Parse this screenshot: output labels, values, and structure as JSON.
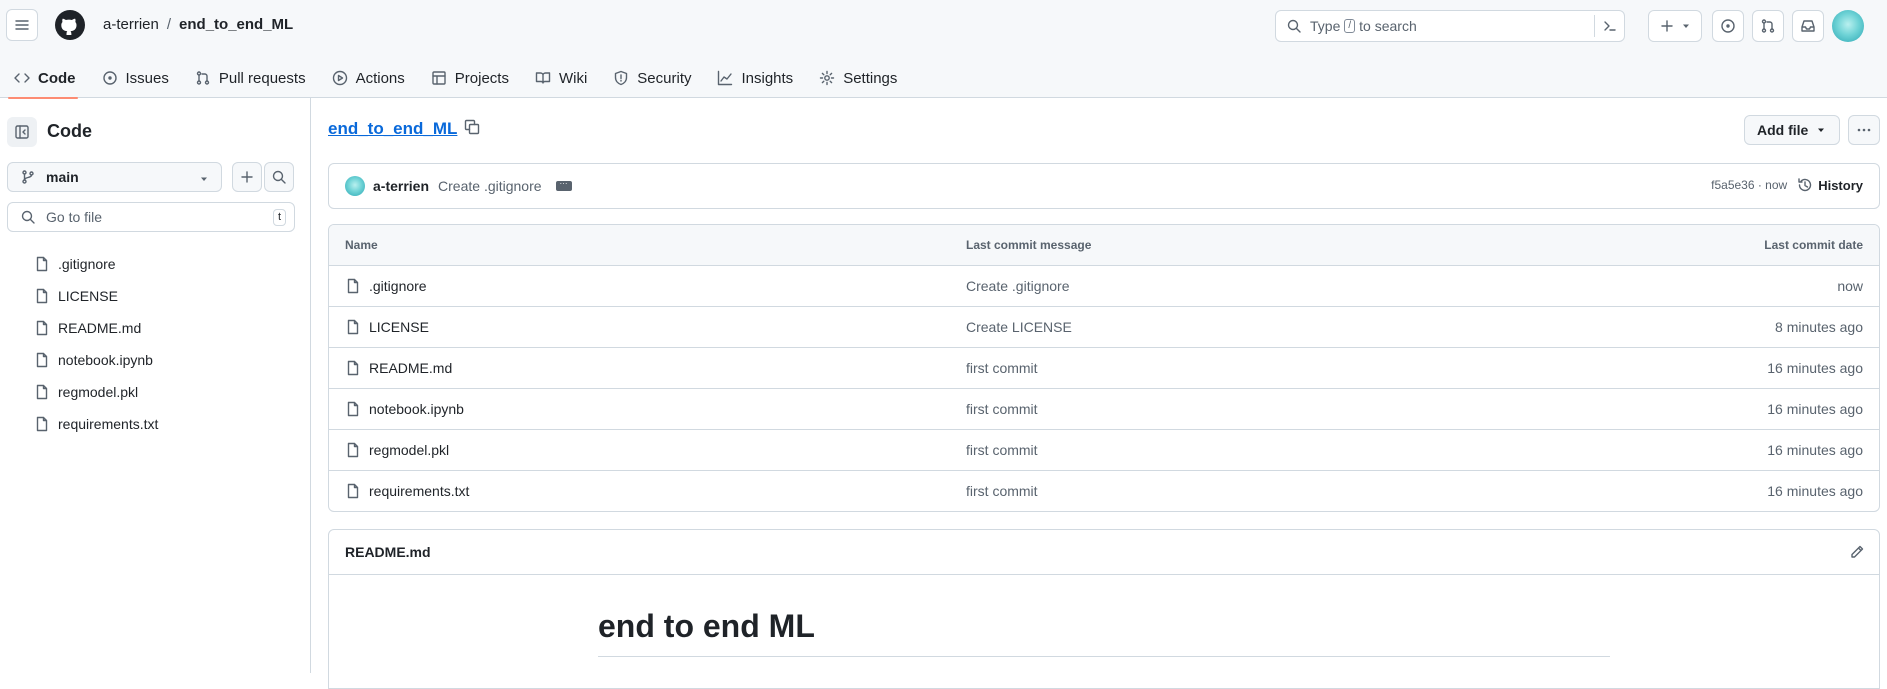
{
  "header": {
    "owner": "a-terrien",
    "separator": "/",
    "repo": "end_to_end_ML",
    "search_prefix": "Type",
    "search_key": "/",
    "search_suffix": "to search"
  },
  "nav": {
    "tabs": [
      {
        "label": "Code",
        "icon": "code-icon",
        "active": true
      },
      {
        "label": "Issues",
        "icon": "issue-icon"
      },
      {
        "label": "Pull requests",
        "icon": "pull-request-icon"
      },
      {
        "label": "Actions",
        "icon": "play-icon"
      },
      {
        "label": "Projects",
        "icon": "table-icon"
      },
      {
        "label": "Wiki",
        "icon": "book-icon"
      },
      {
        "label": "Security",
        "icon": "shield-icon"
      },
      {
        "label": "Insights",
        "icon": "graph-icon"
      },
      {
        "label": "Settings",
        "icon": "gear-icon"
      }
    ]
  },
  "sidebar": {
    "title": "Code",
    "branch": "main",
    "goto_placeholder": "Go to file",
    "goto_key": "t",
    "files": [
      ".gitignore",
      "LICENSE",
      "README.md",
      "notebook.ipynb",
      "regmodel.pkl",
      "requirements.txt"
    ]
  },
  "main": {
    "repo_name": "end_to_end_ML",
    "add_file_label": "Add file",
    "commit": {
      "author": "a-terrien",
      "message": "Create .gitignore",
      "sha_time": "f5a5e36 · now",
      "history_label": "History"
    },
    "table": {
      "headers": {
        "name": "Name",
        "message": "Last commit message",
        "date": "Last commit date"
      },
      "rows": [
        {
          "name": ".gitignore",
          "message": "Create .gitignore",
          "date": "now"
        },
        {
          "name": "LICENSE",
          "message": "Create LICENSE",
          "date": "8 minutes ago"
        },
        {
          "name": "README.md",
          "message": "first commit",
          "date": "16 minutes ago"
        },
        {
          "name": "notebook.ipynb",
          "message": "first commit",
          "date": "16 minutes ago"
        },
        {
          "name": "regmodel.pkl",
          "message": "first commit",
          "date": "16 minutes ago"
        },
        {
          "name": "requirements.txt",
          "message": "first commit",
          "date": "16 minutes ago"
        }
      ]
    },
    "readme": {
      "filename": "README.md",
      "heading": "end to end ML"
    }
  },
  "colors": {
    "link": "#0969da",
    "active_tab_underline": "#fd8c73",
    "border": "#d1d9e0",
    "muted": "#59636e"
  }
}
